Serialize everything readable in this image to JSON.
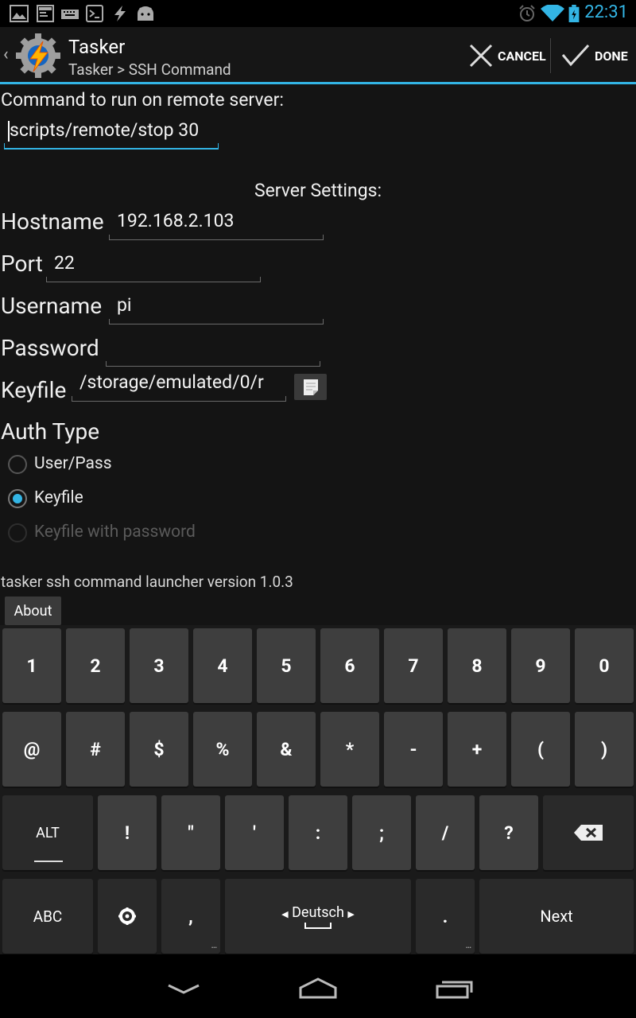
{
  "status_bar": {
    "time": "22:31",
    "left_icons": [
      "gallery-icon",
      "terminal-icon",
      "keyboard-icon",
      "console-icon",
      "tasker-bolt-icon",
      "android-icon"
    ],
    "right_icons": [
      "alarm-icon",
      "wifi-icon",
      "battery-icon"
    ]
  },
  "action_bar": {
    "title": "Tasker",
    "subtitle": "Tasker > SSH Command",
    "cancel_label": "CANCEL",
    "done_label": "DONE"
  },
  "form": {
    "command_label": "Command to run on remote server:",
    "command_value": "scripts/remote/stop 30",
    "server_settings_label": "Server Settings:",
    "hostname_label": "Hostname",
    "hostname_value": "192.168.2.103",
    "port_label": "Port",
    "port_value": "22",
    "username_label": "Username",
    "username_value": "pi",
    "password_label": "Password",
    "password_value": "",
    "keyfile_label": "Keyfile",
    "keyfile_value": "/storage/emulated/0/r",
    "auth_type_label": "Auth Type",
    "auth_options": [
      {
        "label": "User/Pass",
        "selected": false,
        "enabled": true
      },
      {
        "label": "Keyfile",
        "selected": true,
        "enabled": true
      },
      {
        "label": "Keyfile with password",
        "selected": false,
        "enabled": false
      }
    ],
    "version_text": "tasker ssh command launcher version 1.0.3",
    "about_label": "About"
  },
  "keyboard": {
    "row1": [
      "1",
      "2",
      "3",
      "4",
      "5",
      "6",
      "7",
      "8",
      "9",
      "0"
    ],
    "row2": [
      "@",
      "#",
      "$",
      "%",
      "&",
      "*",
      "-",
      "+",
      "(",
      ")"
    ],
    "row3": [
      "ALT",
      "!",
      "\"",
      "'",
      ":",
      ";",
      "/",
      "?",
      "delete-icon"
    ],
    "row4": {
      "abc": "ABC",
      "settings_icon": "settings-icon",
      "comma": ",",
      "space": "Deutsch",
      "period": ".",
      "next": "Next"
    }
  },
  "nav_bar": [
    "back-icon",
    "home-icon",
    "recents-icon"
  ],
  "colors": {
    "accent": "#33b5e5",
    "background": "#121212",
    "key": "#3e3e3e"
  }
}
